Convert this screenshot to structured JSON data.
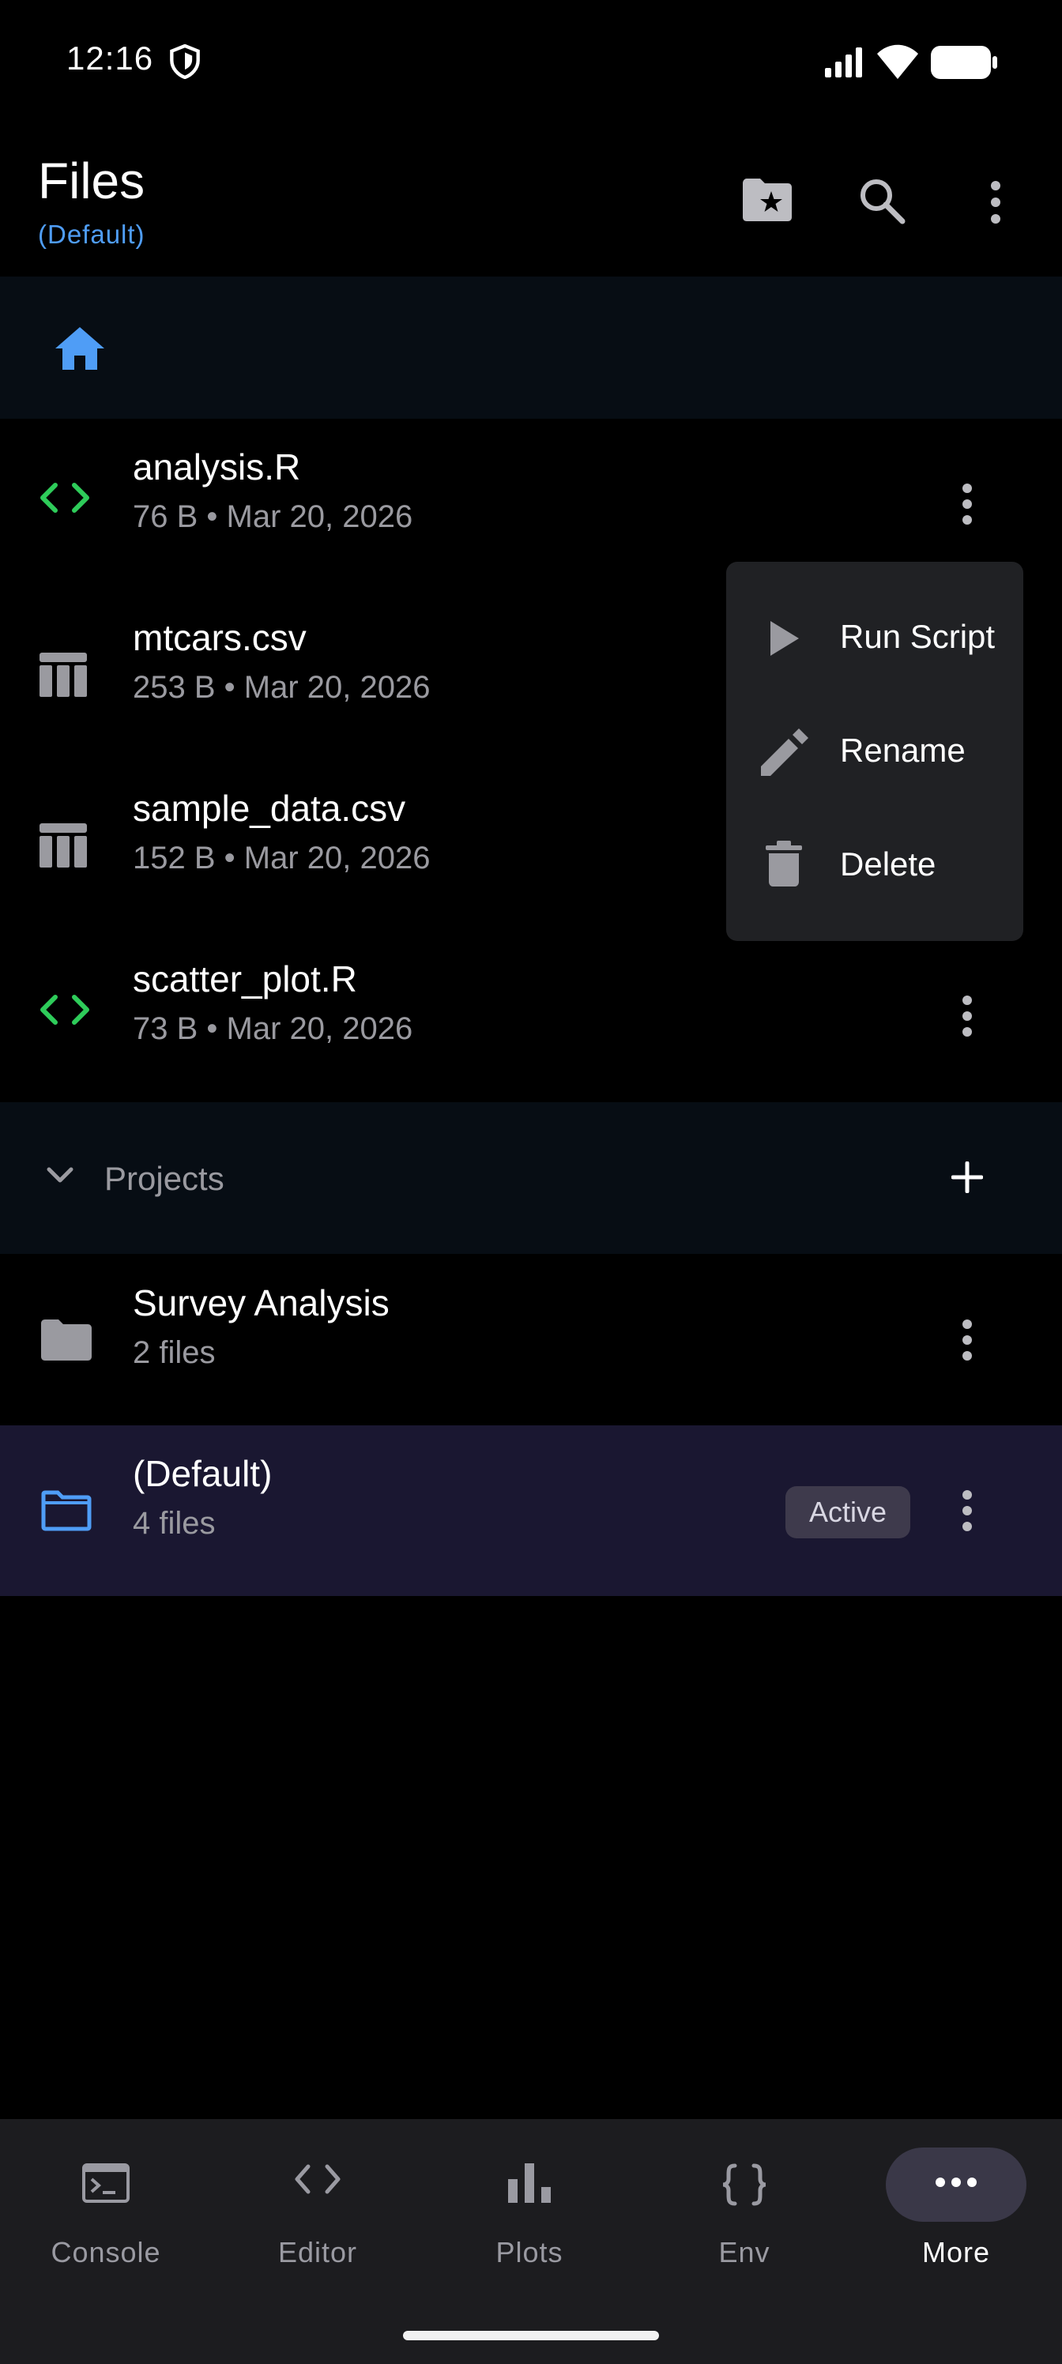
{
  "status_bar": {
    "time": "12:16"
  },
  "header": {
    "title": "Files",
    "subtitle": "(Default)",
    "icons": [
      "folder-star-icon",
      "search-icon",
      "more-vert-icon"
    ]
  },
  "breadcrumb": {
    "icon": "home-icon"
  },
  "files": [
    {
      "name": "analysis.R",
      "meta": "76 B • Mar 20, 2026",
      "type": "code"
    },
    {
      "name": "mtcars.csv",
      "meta": "253 B • Mar 20, 2026",
      "type": "table"
    },
    {
      "name": "sample_data.csv",
      "meta": "152 B • Mar 20, 2026",
      "type": "table"
    },
    {
      "name": "scatter_plot.R",
      "meta": "73 B • Mar 20, 2026",
      "type": "code"
    }
  ],
  "projects": {
    "label": "Projects",
    "items": [
      {
        "name": "Survey Analysis",
        "meta": "2 files",
        "active": false
      },
      {
        "name": "(Default)",
        "meta": "4 files",
        "active": true,
        "badge": "Active"
      }
    ]
  },
  "context_menu": {
    "items": [
      {
        "label": "Run Script",
        "icon": "play-icon"
      },
      {
        "label": "Rename",
        "icon": "edit-icon"
      },
      {
        "label": "Delete",
        "icon": "delete-icon"
      }
    ]
  },
  "bottom_nav": {
    "items": [
      {
        "label": "Console",
        "icon": "console-icon"
      },
      {
        "label": "Editor",
        "icon": "code-icon"
      },
      {
        "label": "Plots",
        "icon": "bar-chart-icon"
      },
      {
        "label": "Env",
        "icon": "braces-icon"
      },
      {
        "label": "More",
        "icon": "more-horiz-icon",
        "selected": true
      }
    ]
  },
  "colors": {
    "accent_blue": "#4f9df6",
    "code_green": "#2ecc5a",
    "active_row_bg": "#1a1731",
    "menu_bg": "#202124"
  }
}
